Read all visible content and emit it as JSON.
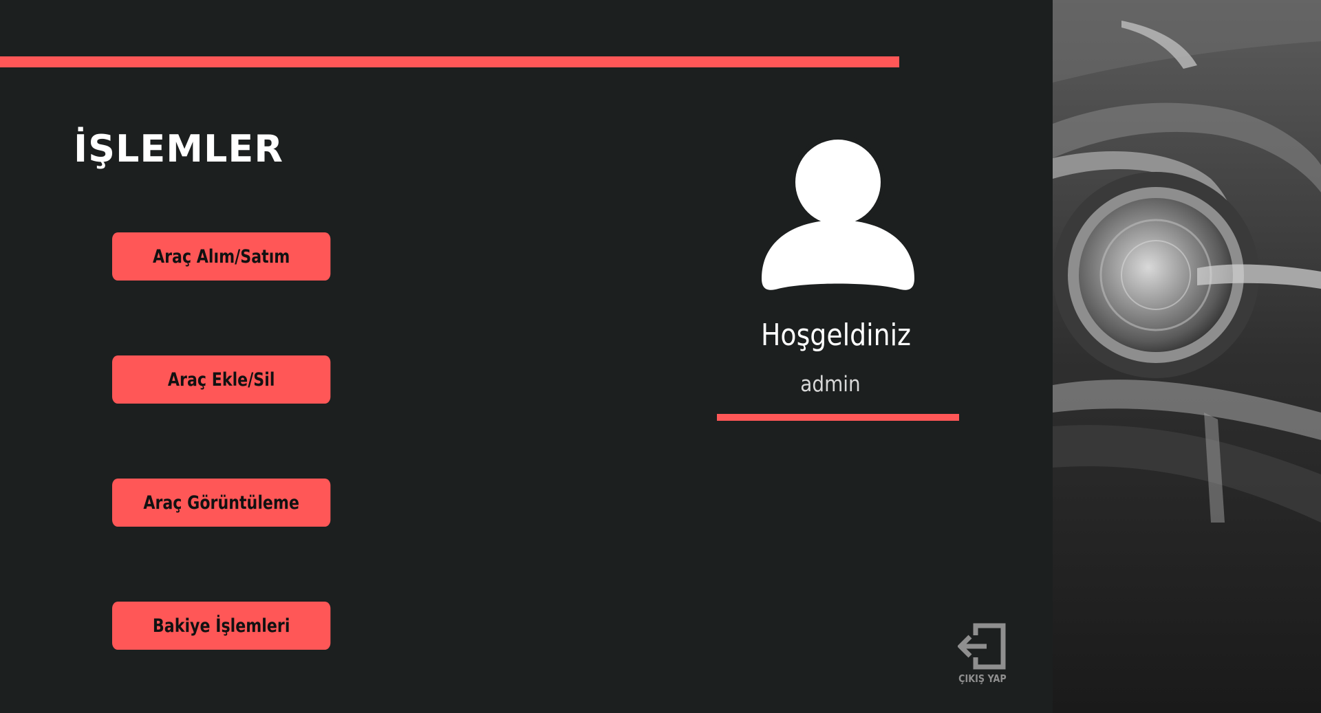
{
  "header": {
    "title": "İŞLEMLER"
  },
  "menu": {
    "items": [
      {
        "label": "Araç Alım/Satım"
      },
      {
        "label": "Araç Ekle/Sil"
      },
      {
        "label": "Araç Görüntüleme"
      },
      {
        "label": "Bakiye İşlemleri"
      }
    ]
  },
  "profile": {
    "welcome": "Hoşgeldiniz",
    "username": "admin",
    "avatar_icon": "user-icon"
  },
  "logout": {
    "label": "ÇIKIŞ YAP",
    "icon": "logout-icon"
  },
  "theme": {
    "accent": "#ff5757",
    "background": "#1c1f1f",
    "text": "#ffffff"
  },
  "decor": {
    "photo": "car-headlight-photo"
  }
}
